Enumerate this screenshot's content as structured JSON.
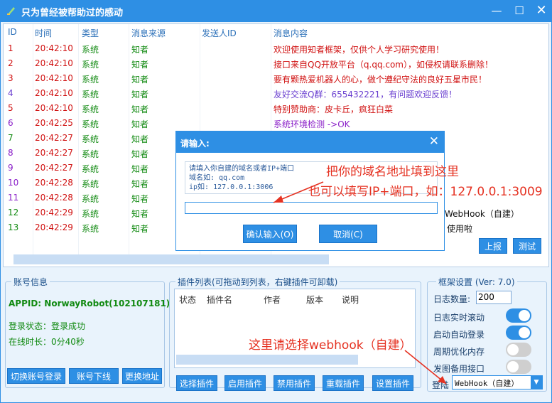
{
  "window": {
    "title": "只为曾经被帮助过的感动"
  },
  "log": {
    "headers": [
      "ID",
      "时间",
      "类型",
      "消息来源",
      "发送人ID",
      "消息内容"
    ],
    "rows": [
      {
        "id": "1",
        "time": "20:42:10",
        "type": "系统",
        "src": "知者",
        "sender": "",
        "msg": "欢迎使用知者框架，仅供个人学习研究使用！",
        "color": "#d01010"
      },
      {
        "id": "2",
        "time": "20:42:10",
        "type": "系统",
        "src": "知者",
        "sender": "",
        "msg": "接口来自QQ开放平台（q.qq.com），如侵权请联系删除！",
        "color": "#d01010"
      },
      {
        "id": "3",
        "time": "20:42:10",
        "type": "系统",
        "src": "知者",
        "sender": "",
        "msg": "要有颗热爱机器人的心，做个遵纪守法的良好五星市民！",
        "color": "#d01010"
      },
      {
        "id": "4",
        "time": "20:42:10",
        "type": "系统",
        "src": "知者",
        "sender": "",
        "msg": "友好交流Q群：655432221，有问题欢迎反馈！",
        "color": "#6a3fd0"
      },
      {
        "id": "5",
        "time": "20:42:10",
        "type": "系统",
        "src": "知者",
        "sender": "",
        "msg": "特别赞助商：皮卡丘，疯狂白菜",
        "color": "#d01010"
      },
      {
        "id": "6",
        "time": "20:42:25",
        "type": "系统",
        "src": "知者",
        "sender": "",
        "msg": "系统环境检测 ->OK",
        "color": "#8a1fc8"
      },
      {
        "id": "7",
        "time": "20:42:27",
        "type": "系统",
        "src": "知者",
        "sender": "",
        "msg": "",
        "color": "#118a11"
      },
      {
        "id": "8",
        "time": "20:42:27",
        "type": "系统",
        "src": "知者",
        "sender": "",
        "msg": "",
        "color": "#8a1fc8"
      },
      {
        "id": "9",
        "time": "20:42:27",
        "type": "系统",
        "src": "知者",
        "sender": "",
        "msg": "",
        "color": "#8a1fc8"
      },
      {
        "id": "10",
        "time": "20:42:28",
        "type": "系统",
        "src": "知者",
        "sender": "",
        "msg": "",
        "color": "#8a1fc8"
      },
      {
        "id": "11",
        "time": "20:42:28",
        "type": "系统",
        "src": "知者",
        "sender": "",
        "msg": "",
        "color": "#8a1fc8"
      },
      {
        "id": "12",
        "time": "20:42:29",
        "type": "系统",
        "src": "知者",
        "sender": "",
        "msg": "WebHook（自建）",
        "color": "#118a11"
      },
      {
        "id": "13",
        "time": "20:42:29",
        "type": "系统",
        "src": "知者",
        "sender": "",
        "msg": "使用啦",
        "color": "#118a11"
      }
    ],
    "report_btn": "上报",
    "test_btn": "测试"
  },
  "account": {
    "title": "账号信息",
    "appid": "APPID: NorwayRobot(102107181)",
    "login_status": "登录状态：登录成功",
    "online": "在线时长：0分40秒",
    "btn_switch": "切换账号登录",
    "btn_logout": "账号下线",
    "btn_change": "更换地址"
  },
  "plugins": {
    "title": "插件列表(可拖动到列表，右键插件可卸载)",
    "headers": [
      "状态",
      "插件名",
      "作者",
      "版本",
      "说明"
    ],
    "btn_select": "选择插件",
    "btn_enable": "启用插件",
    "btn_disable": "禁用插件",
    "btn_reload": "重载插件",
    "btn_settings": "设置插件"
  },
  "framework": {
    "title": "框架设置 (Ver: 7.0)",
    "log_count_label": "日志数量:",
    "log_count_value": "200",
    "opt1": "日志实时滚动",
    "opt2": "启动自动登录",
    "opt3": "周期优化内存",
    "opt4": "发图备用接口",
    "toggles": [
      true,
      true,
      false,
      false
    ],
    "login_label": "登陆",
    "login_selected": "WebHook（自建）"
  },
  "dialog": {
    "title": "请输入:",
    "line1": "请填入你自建的域名或者IP+端口",
    "line2": "域名如: qq.com",
    "line3": "ip如: 127.0.0.1:3006",
    "input_value": "",
    "ok_btn": "确认输入(O)",
    "cancel_btn": "取消(C)"
  },
  "annotations": {
    "a1": "把你的域名地址填到这里",
    "a2": "也可以填写IP+端口，如：127.0.0.1:3009",
    "a3": "这里请选择webhook（自建）"
  },
  "colors": {
    "accent": "#2e8fe4",
    "annotation": "#e53222",
    "toggle_on": "#2e8fe4",
    "toggle_off": "#cfcfcf"
  }
}
